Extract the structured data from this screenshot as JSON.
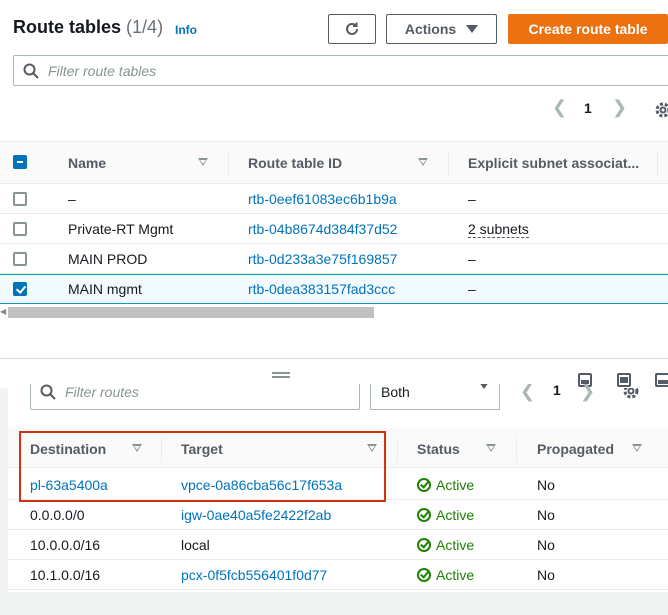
{
  "header": {
    "title": "Route tables",
    "count": "(1/4)",
    "info": "Info",
    "refresh_icon": "refresh-icon",
    "actions_label": "Actions",
    "create_label": "Create route table"
  },
  "filter": {
    "placeholder": "Filter route tables"
  },
  "pagination": {
    "page": "1"
  },
  "table": {
    "columns": [
      "Name",
      "Route table ID",
      "Explicit subnet associat..."
    ],
    "rows": [
      {
        "name": "–",
        "id": "rtb-0eef61083ec6b1b9a",
        "subnets": "–",
        "checked": false
      },
      {
        "name": "Private-RT Mgmt",
        "id": "rtb-04b8674d384f37d52",
        "subnets": "2 subnets",
        "checked": false
      },
      {
        "name": "MAIN PROD",
        "id": "rtb-0d233a3e75f169857",
        "subnets": "–",
        "checked": false
      },
      {
        "name": "MAIN mgmt",
        "id": "rtb-0dea383157fad3ccc",
        "subnets": "–",
        "checked": true
      }
    ]
  },
  "routes": {
    "filter_placeholder": "Filter routes",
    "select_value": "Both",
    "page": "1",
    "columns": [
      "Destination",
      "Target",
      "Status",
      "Propagated"
    ],
    "rows": [
      {
        "destination": "pl-63a5400a",
        "target": "vpce-0a86cba56c17f653a",
        "status": "Active",
        "propagated": "No"
      },
      {
        "destination": "0.0.0.0/0",
        "target": "igw-0ae40a5fe2422f2ab",
        "status": "Active",
        "propagated": "No"
      },
      {
        "destination": "10.0.0.0/16",
        "target": "local",
        "status": "Active",
        "propagated": "No"
      },
      {
        "destination": "10.1.0.0/16",
        "target": "pcx-0f5fcb556401f0d77",
        "status": "Active",
        "propagated": "No"
      }
    ]
  }
}
